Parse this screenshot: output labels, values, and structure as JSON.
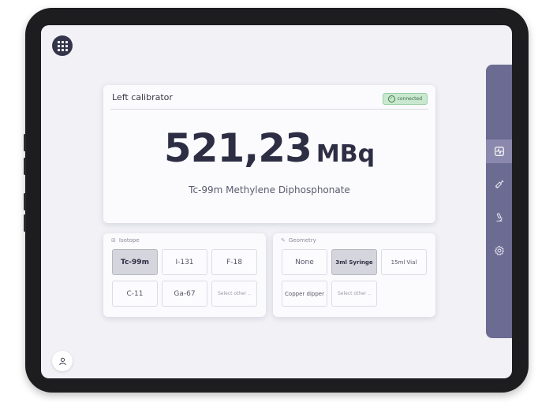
{
  "calibrator": {
    "title": "Left calibrator",
    "status": "connected",
    "activity_value": "521,23",
    "activity_unit": "MBq",
    "substance": "Tc-99m Methylene Diphosphonate"
  },
  "isotope": {
    "heading": "Isotope",
    "options": [
      "Tc-99m",
      "I-131",
      "F-18",
      "C-11",
      "Ga-67",
      "Select other .."
    ],
    "selected": "Tc-99m"
  },
  "geometry": {
    "heading": "Geometry",
    "options": [
      "None",
      "3ml Syringe",
      "15ml Vial",
      "Copper dipper",
      "Select other .."
    ],
    "selected": "3ml Syringe"
  },
  "sidebar": {
    "items": [
      "activity-icon",
      "syringe-icon",
      "microscope-icon",
      "gear-icon"
    ],
    "active": "activity-icon"
  },
  "colors": {
    "accent": "#6c6b92",
    "connected_bg": "#c9e8cf",
    "value_text": "#2d2e44"
  }
}
